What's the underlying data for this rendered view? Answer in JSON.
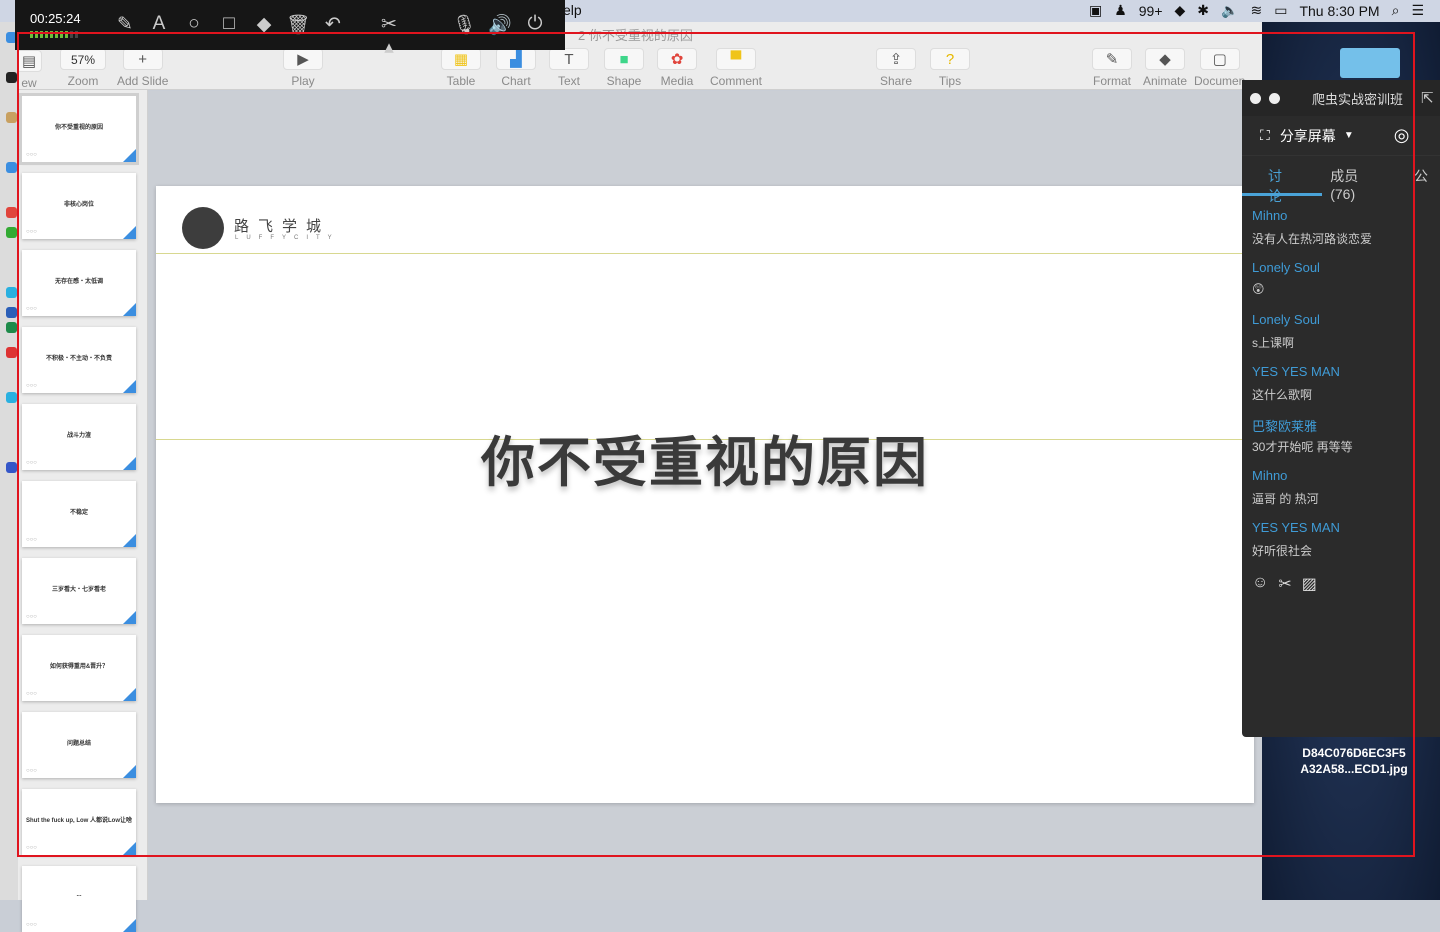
{
  "menubar": {
    "help_menu": "elp",
    "status": [
      "99+"
    ],
    "clock": "Thu 8:30 PM"
  },
  "document": {
    "title": "2 你不受重视的原因"
  },
  "recorder": {
    "elapsed": "00:25:24",
    "level_fraction": 0.8
  },
  "toolbar": {
    "view": "ew",
    "zoom_value": "57%",
    "zoom": "Zoom",
    "add_slide": "Add Slide",
    "play": "Play",
    "table": "Table",
    "chart": "Chart",
    "text": "Text",
    "shape": "Shape",
    "media": "Media",
    "comment": "Comment",
    "share": "Share",
    "tips": "Tips",
    "format": "Format",
    "animate": "Animate",
    "document": "Documen"
  },
  "slides": [
    {
      "title": "你不受重视的原因"
    },
    {
      "title": "非核心岗位"
    },
    {
      "title": "无存在感・太低调"
    },
    {
      "title": "不积极・不主动・不负责"
    },
    {
      "title": "战斗力渣"
    },
    {
      "title": "不稳定"
    },
    {
      "title": "三岁看大・七岁看老"
    },
    {
      "title": "如何获得重用&晋升？"
    },
    {
      "title": "问题总结"
    },
    {
      "title": "Shut the fuck up, Low 人都说Low让啥"
    },
    {
      "title": "..."
    }
  ],
  "slide": {
    "logo_name": "路飞学城",
    "logo_sub": "LUFFYCITY",
    "title": "你不受重视的原因"
  },
  "desktop": {
    "file_label_1": "D84C076D6EC3F5",
    "file_label_2": "A32A58...ECD1.jpg"
  },
  "chat": {
    "room": "爬虫实战密训班",
    "share_screen": "分享屏幕",
    "tabs": [
      "讨论",
      "成员(76)",
      "公"
    ],
    "messages": [
      {
        "user": "Mihno",
        "text": "没有人在热河路谈恋爱"
      },
      {
        "user": "Lonely Soul",
        "text": "😲"
      },
      {
        "user": "Lonely Soul",
        "text": "s上课啊"
      },
      {
        "user": "YES YES MAN",
        "text": "这什么歌啊"
      },
      {
        "user": "巴黎欧莱雅",
        "text": "30才开始呢 再等等"
      },
      {
        "user": "Mihno",
        "text": "逼哥 的 热河"
      },
      {
        "user": "YES YES MAN",
        "text": "好听很社会"
      }
    ]
  },
  "colors": {
    "accent": "#3f9bd6",
    "record": "#e0141e"
  }
}
